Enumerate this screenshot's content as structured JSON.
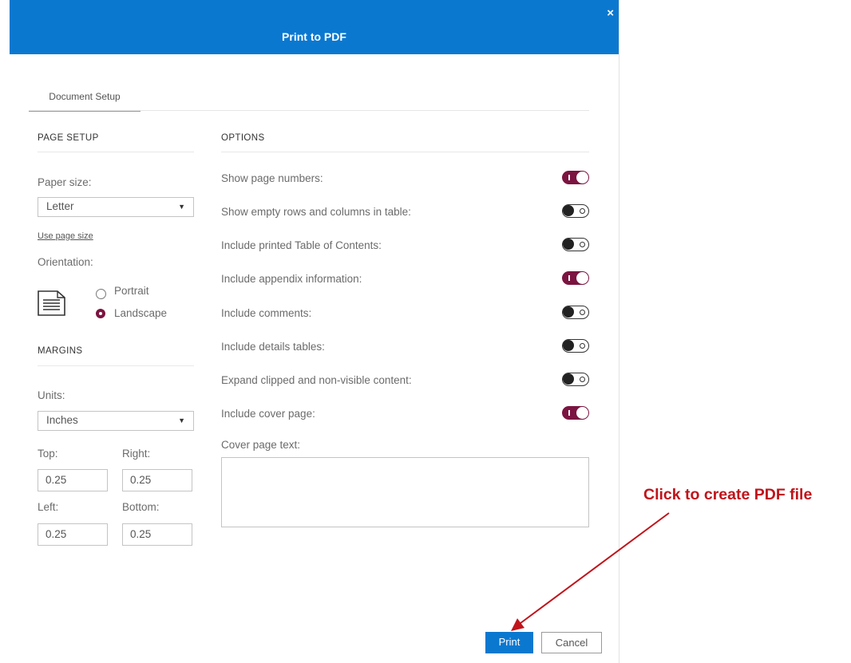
{
  "dialog": {
    "title": "Print to PDF",
    "close_glyph": "×"
  },
  "tabs": [
    {
      "label": "Document Setup",
      "active": true
    }
  ],
  "page_setup": {
    "heading": "PAGE SETUP",
    "paper_size_label": "Paper size:",
    "paper_size_value": "Letter",
    "use_page_size_link": "Use page size",
    "orientation_label": "Orientation:",
    "orientation_options": [
      {
        "label": "Portrait",
        "selected": false
      },
      {
        "label": "Landscape",
        "selected": true
      }
    ]
  },
  "margins": {
    "heading": "MARGINS",
    "units_label": "Units:",
    "units_value": "Inches",
    "top_label": "Top:",
    "top_value": "0.25",
    "right_label": "Right:",
    "right_value": "0.25",
    "left_label": "Left:",
    "left_value": "0.25",
    "bottom_label": "Bottom:",
    "bottom_value": "0.25"
  },
  "options": {
    "heading": "OPTIONS",
    "items": [
      {
        "label": "Show page numbers:",
        "on": true
      },
      {
        "label": "Show empty rows and columns in table:",
        "on": false
      },
      {
        "label": "Include printed Table of Contents:",
        "on": false
      },
      {
        "label": "Include appendix information:",
        "on": true
      },
      {
        "label": "Include comments:",
        "on": false
      },
      {
        "label": "Include details tables:",
        "on": false
      },
      {
        "label": "Expand clipped and non-visible content:",
        "on": false
      },
      {
        "label": "Include cover page:",
        "on": true
      }
    ],
    "cover_page_text_label": "Cover page text:",
    "cover_page_text_value": ""
  },
  "buttons": {
    "print": "Print",
    "cancel": "Cancel"
  },
  "annotation": {
    "text": "Click to create PDF file",
    "color": "#c0141b"
  },
  "colors": {
    "header": "#0b78d0",
    "toggle_on": "#7b1440"
  },
  "icons": [
    "close-icon",
    "chevron-down-icon",
    "document-icon",
    "arrow-annotation"
  ]
}
